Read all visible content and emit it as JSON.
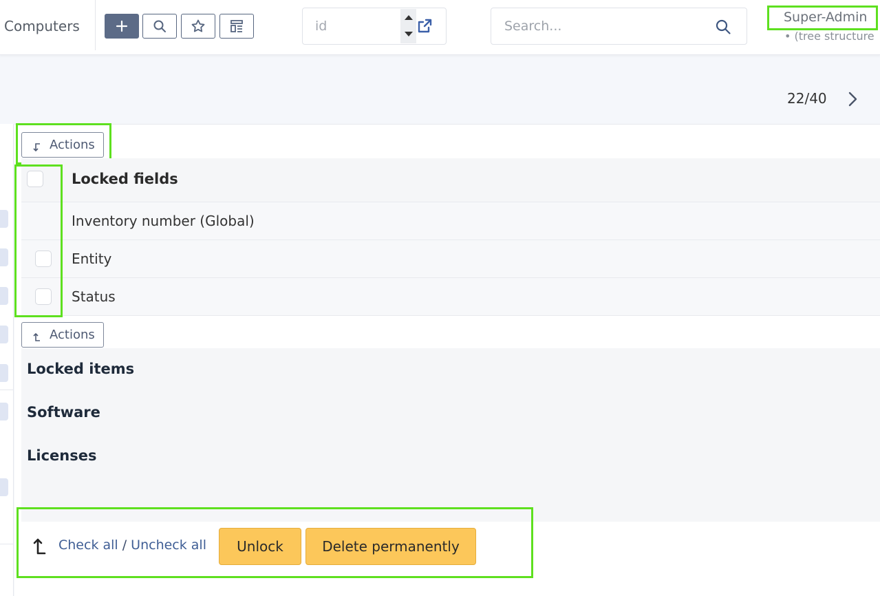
{
  "header": {
    "breadcrumb": "Computers",
    "add_icon": "plus-icon",
    "search_icon": "search-icon",
    "saved_searches_icon": "star-icon",
    "templates_icon": "template-icon",
    "id_placeholder": "id",
    "search_placeholder": "Search...",
    "profile_name": "Super-Admin",
    "profile_sub": "• (tree structure"
  },
  "pager": {
    "text": "22/40"
  },
  "actions": {
    "top_label": "Actions",
    "bottom_label": "Actions"
  },
  "locked_fields": {
    "header": "Locked fields",
    "rows": [
      {
        "label": "Inventory number (Global)",
        "has_checkbox": false
      },
      {
        "label": "Entity",
        "has_checkbox": true
      },
      {
        "label": "Status",
        "has_checkbox": true
      }
    ]
  },
  "sections": {
    "locked_items": "Locked items",
    "software": "Software",
    "licenses": "Licenses"
  },
  "mass_actions": {
    "check_all": "Check all",
    "separator": " / ",
    "uncheck_all": "Uncheck all",
    "unlock": "Unlock",
    "delete_permanently": "Delete permanently"
  },
  "colors": {
    "primary": "#5c6b87",
    "warning_button": "#fcc75a",
    "highlight": "#5ee01f"
  }
}
